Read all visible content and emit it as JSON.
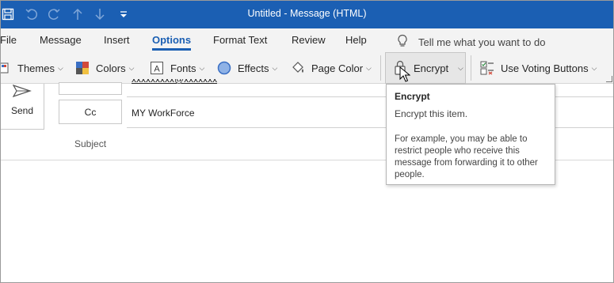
{
  "window": {
    "title": "Untitled  -  Message (HTML)"
  },
  "quick_access": {
    "icons": [
      "save-icon",
      "undo-icon",
      "redo-icon",
      "up-arrow-icon",
      "down-arrow-icon",
      "customize-qat-icon"
    ]
  },
  "tabs": [
    {
      "label": "File"
    },
    {
      "label": "Message"
    },
    {
      "label": "Insert"
    },
    {
      "label": "Options"
    },
    {
      "label": "Format Text"
    },
    {
      "label": "Review"
    },
    {
      "label": "Help"
    }
  ],
  "active_tab": "Options",
  "tell_me": {
    "text": "Tell me what you want to do"
  },
  "ribbon": {
    "themes": "Themes",
    "colors": "Colors",
    "fonts": "Fonts",
    "effects": "Effects",
    "page_color": "Page Color",
    "encrypt": "Encrypt",
    "voting": "Use Voting Buttons"
  },
  "compose": {
    "send": "Send",
    "cc_button": "Cc",
    "cc_value": "MY WorkForce",
    "subject_label": "Subject"
  },
  "tooltip": {
    "title": "Encrypt",
    "description": "Encrypt this item.",
    "example_line1": "For example, you may be able to",
    "example_line2": "restrict people who receive this",
    "example_line3": "message from forwarding it to other",
    "example_line4": "people."
  },
  "colors": {
    "accent": "#1b5fb3",
    "ribbon_bg": "#f3f3f3",
    "encrypt_hover_bg": "#e6e6e6"
  }
}
